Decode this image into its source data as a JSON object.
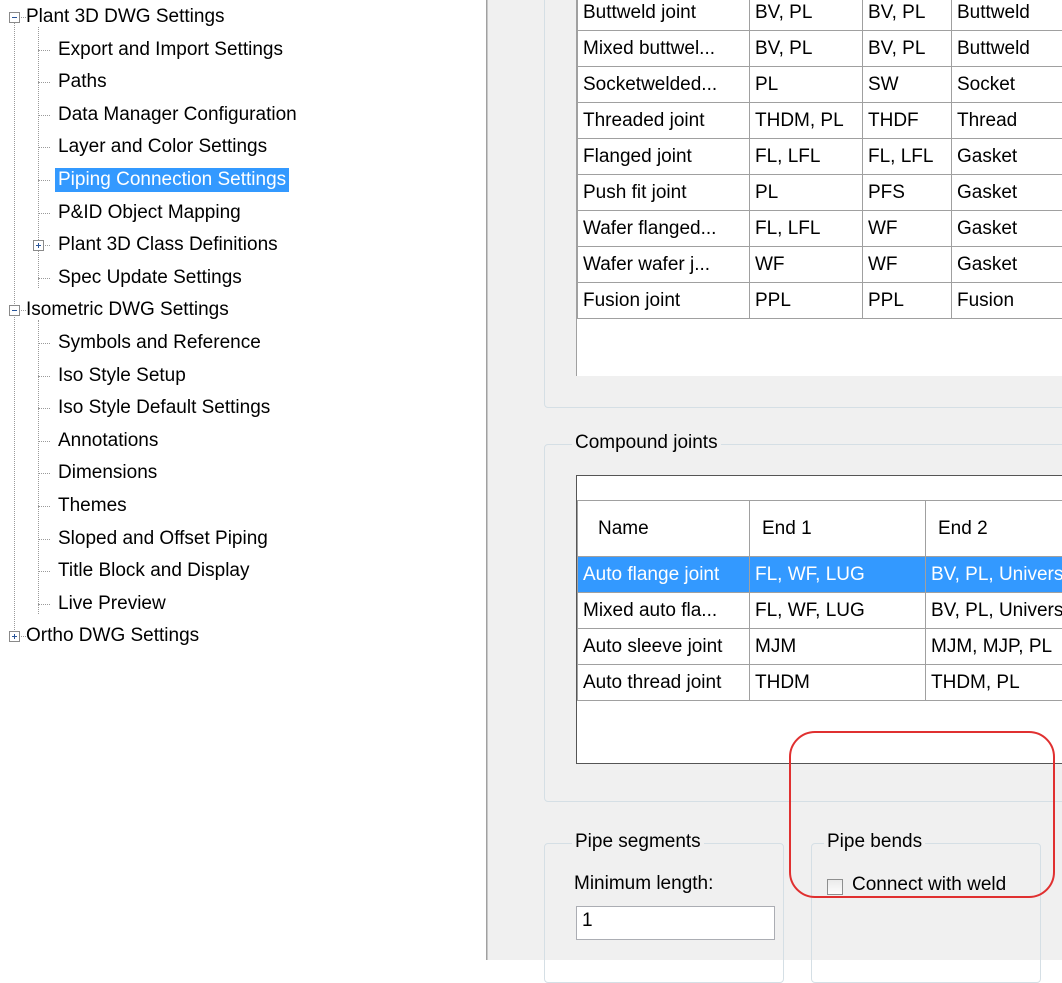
{
  "tree": {
    "items": [
      {
        "label": "Plant 3D DWG Settings",
        "level": 0,
        "expander": "minus"
      },
      {
        "label": "Export and Import Settings",
        "level": 1
      },
      {
        "label": "Paths",
        "level": 1
      },
      {
        "label": "Data Manager Configuration",
        "level": 1
      },
      {
        "label": "Layer and Color Settings",
        "level": 1
      },
      {
        "label": "Piping Connection Settings",
        "level": 1,
        "selected": true
      },
      {
        "label": "P&ID Object Mapping",
        "level": 1
      },
      {
        "label": "Plant 3D Class Definitions",
        "level": 1,
        "expander": "plus"
      },
      {
        "label": "Spec Update Settings",
        "level": 1
      },
      {
        "label": "Isometric DWG Settings",
        "level": 0,
        "expander": "minus"
      },
      {
        "label": "Symbols and Reference",
        "level": 1
      },
      {
        "label": "Iso Style Setup",
        "level": 1
      },
      {
        "label": "Iso Style Default Settings",
        "level": 1
      },
      {
        "label": "Annotations",
        "level": 1
      },
      {
        "label": "Dimensions",
        "level": 1
      },
      {
        "label": "Themes",
        "level": 1
      },
      {
        "label": "Sloped and Offset Piping",
        "level": 1
      },
      {
        "label": "Title Block and Display",
        "level": 1
      },
      {
        "label": "Live Preview",
        "level": 1
      },
      {
        "label": "Ortho DWG Settings",
        "level": 0,
        "expander": "plus"
      }
    ]
  },
  "joints_table": {
    "rows": [
      [
        "Buttweld joint",
        "BV, PL",
        "BV, PL",
        "Buttweld"
      ],
      [
        "Mixed buttwel...",
        "BV, PL",
        "BV, PL",
        "Buttweld"
      ],
      [
        "Socketwelded...",
        "PL",
        "SW",
        "Socket"
      ],
      [
        "Threaded joint",
        "THDM, PL",
        "THDF",
        "Thread"
      ],
      [
        "Flanged joint",
        "FL, LFL",
        "FL, LFL",
        "Gasket"
      ],
      [
        "Push fit joint",
        "PL",
        "PFS",
        "Gasket"
      ],
      [
        "Wafer flanged...",
        "FL, LFL",
        "WF",
        "Gasket"
      ],
      [
        "Wafer wafer j...",
        "WF",
        "WF",
        "Gasket"
      ],
      [
        "Fusion joint",
        "PPL",
        "PPL",
        "Fusion"
      ]
    ]
  },
  "compound": {
    "title": "Compound joints",
    "headers": [
      "Name",
      "End 1",
      "End 2"
    ],
    "rows": [
      [
        "Auto flange joint",
        "FL, WF, LUG",
        "BV, PL, Universal"
      ],
      [
        "Mixed auto fla...",
        "FL, WF, LUG",
        "BV, PL, Universal"
      ],
      [
        "Auto sleeve joint",
        "MJM",
        "MJM, MJP, PL"
      ],
      [
        "Auto thread joint",
        "THDM",
        "THDM, PL"
      ]
    ],
    "selected_row": 0
  },
  "pipe_segments": {
    "title": "Pipe segments",
    "min_length_label": "Minimum length:",
    "min_length_value": "1"
  },
  "pipe_bends": {
    "title": "Pipe bends",
    "connect_label": "Connect with weld",
    "checked": false
  },
  "colors": {
    "selection": "#3399ff",
    "highlight_ring": "#e03030",
    "panel_bg": "#f0f0f0"
  }
}
